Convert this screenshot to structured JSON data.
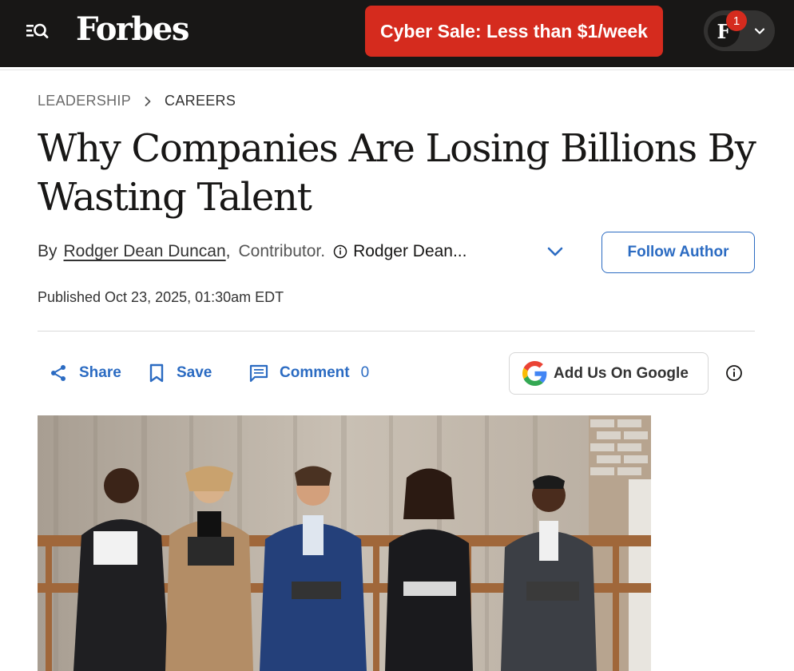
{
  "header": {
    "logo_text": "Forbes",
    "promo_label": "Cyber Sale: Less than $1/week",
    "account_initial": "F",
    "notification_count": "1"
  },
  "breadcrumb": {
    "parent": "LEADERSHIP",
    "current": "CAREERS"
  },
  "article": {
    "title": "Why Companies Are Losing Billions By Wasting Talent",
    "by_label": "By",
    "author_name": "Rodger Dean Duncan",
    "author_comma": ",",
    "author_role": "Contributor.",
    "author_truncated": "Rodger Dean...",
    "follow_label": "Follow Author",
    "published": "Published Oct 23, 2025, 01:30am EDT"
  },
  "actions": {
    "share_label": "Share",
    "save_label": "Save",
    "comment_label": "Comment",
    "comment_count": "0",
    "google_label": "Add Us On Google"
  },
  "colors": {
    "header_bg": "#181716",
    "promo_red": "#d52b1e",
    "link_blue": "#2b6bc2"
  }
}
